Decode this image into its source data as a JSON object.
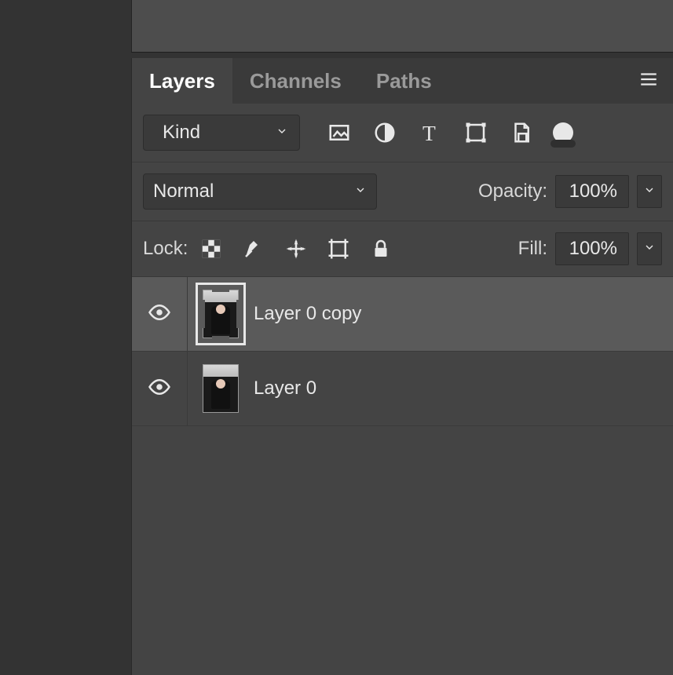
{
  "tabs": {
    "layers": "Layers",
    "channels": "Channels",
    "paths": "Paths",
    "active": "layers"
  },
  "filter": {
    "label": "Kind"
  },
  "blend": {
    "mode": "Normal"
  },
  "opacity": {
    "label": "Opacity:",
    "value": "100%"
  },
  "lock": {
    "label": "Lock:"
  },
  "fill": {
    "label": "Fill:",
    "value": "100%"
  },
  "layers": [
    {
      "name": "Layer 0 copy",
      "visible": true,
      "selected": true
    },
    {
      "name": "Layer 0",
      "visible": true,
      "selected": false
    }
  ]
}
